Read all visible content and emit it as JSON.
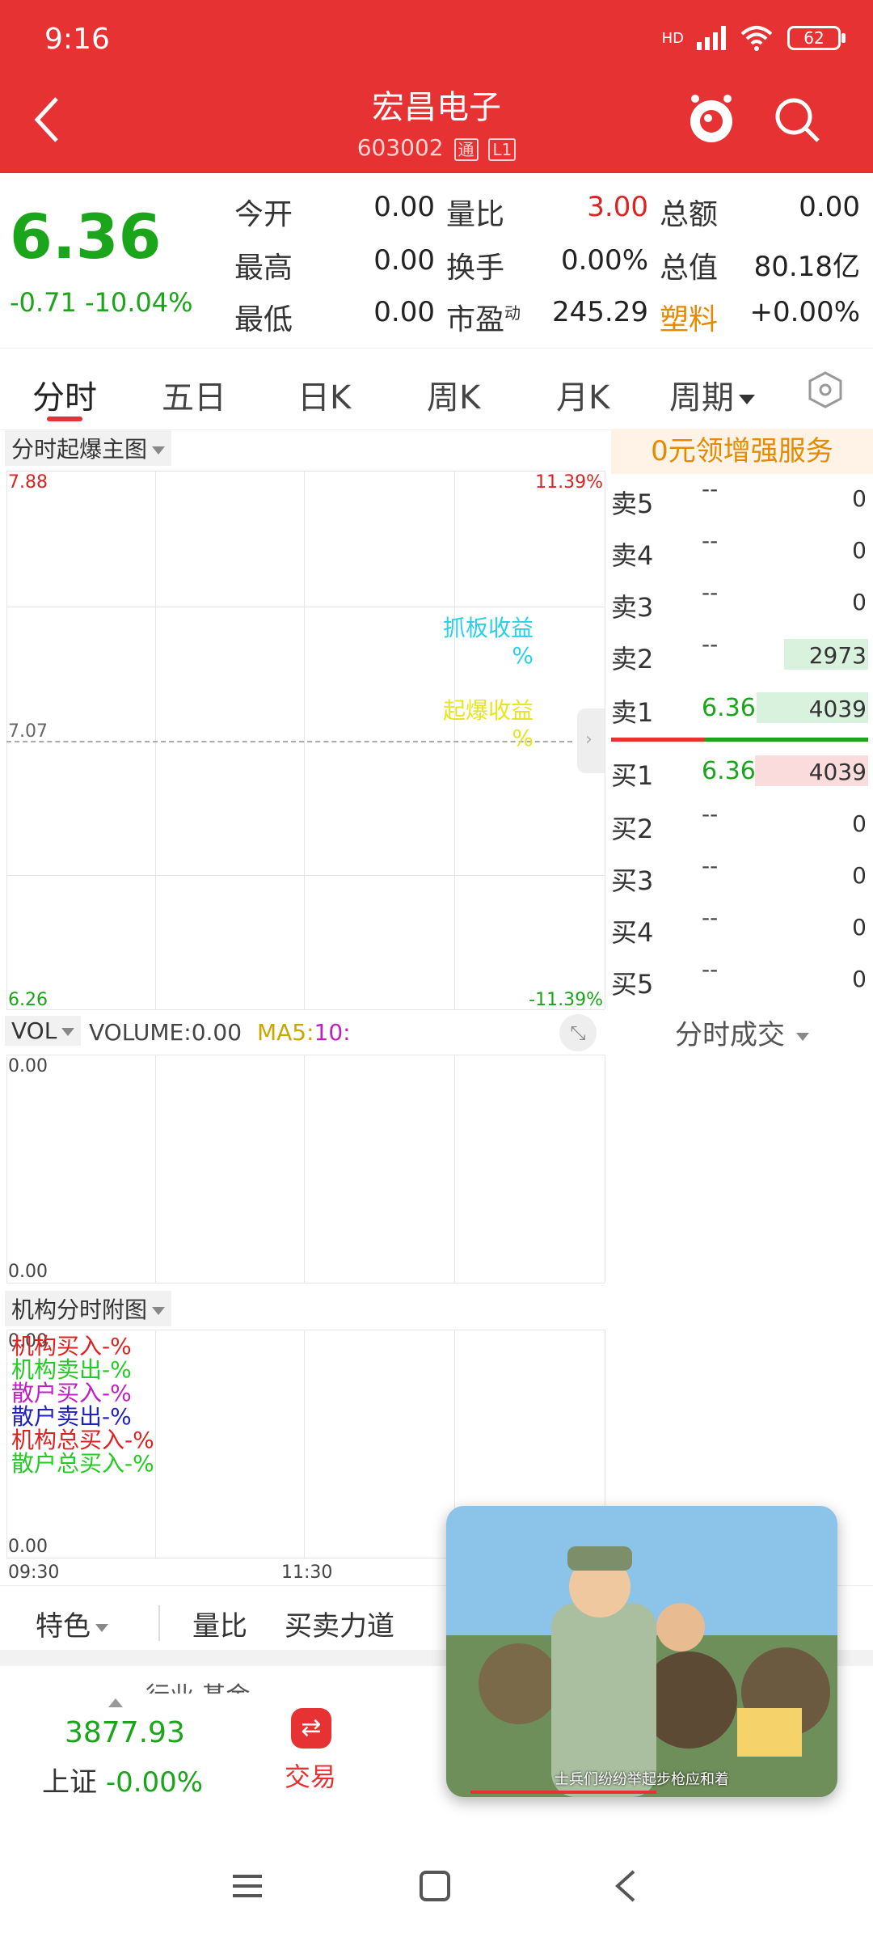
{
  "status": {
    "time": "9:16",
    "network": "HD",
    "battery": "62"
  },
  "header": {
    "title": "宏昌电子",
    "code": "603002",
    "tag1": "通",
    "tag2": "L1"
  },
  "quote": {
    "price": "6.36",
    "change": "-0.71",
    "change_pct": "-10.04%",
    "rows": [
      [
        {
          "label": "今开",
          "value": "0.00"
        },
        {
          "label": "量比",
          "value": "3.00"
        },
        {
          "label": "总额",
          "value": "0.00"
        }
      ],
      [
        {
          "label": "最高",
          "value": "0.00"
        },
        {
          "label": "换手",
          "value": "0.00%"
        },
        {
          "label": "总值",
          "value": "80.18亿"
        }
      ],
      [
        {
          "label": "最低",
          "value": "0.00"
        },
        {
          "label": "市盈",
          "sup": "动",
          "value": "245.29"
        },
        {
          "label": "塑料",
          "value": "+0.00%"
        }
      ]
    ]
  },
  "tabs": [
    "分时",
    "五日",
    "日K",
    "周K",
    "月K",
    "周期"
  ],
  "chart": {
    "main_select": "分时起爆主图",
    "y_top": "7.88",
    "y_mid": "7.07",
    "y_bot": "6.26",
    "pct_top": "11.39%",
    "pct_bot": "-11.39%",
    "label_grab": "抓板收益",
    "label_grab_unit": "%",
    "label_burst": "起爆收益",
    "label_burst_unit": "%",
    "vol_select": "VOL",
    "volume_text": "VOLUME:",
    "volume_val": "0.00",
    "ma5_text": "MA5:",
    "ma5_val": "10:",
    "vol_top": "0.00",
    "vol_bot": "0.00",
    "inst_select": "机构分时附图",
    "inst_top": "0.00",
    "inst_bot": "0.00",
    "inst_lines": [
      {
        "text": "机构买入-%",
        "color": "#d22"
      },
      {
        "text": "机构卖出-%",
        "color": "#22cc22"
      },
      {
        "text": "散户买入-%",
        "color": "#c020c0"
      },
      {
        "text": "散户卖出-%",
        "color": "#2020c0"
      },
      {
        "text": "机构总买入-%",
        "color": "#d22"
      },
      {
        "text": "散户总买入-%",
        "color": "#22cc22"
      }
    ],
    "time_start": "09:30",
    "time_mid": "11:30"
  },
  "orderbook": {
    "promo": "0元领增强服务",
    "sells": [
      {
        "label": "卖5",
        "price": "--",
        "vol": "0"
      },
      {
        "label": "卖4",
        "price": "--",
        "vol": "0"
      },
      {
        "label": "卖3",
        "price": "--",
        "vol": "0"
      },
      {
        "label": "卖2",
        "price": "--",
        "vol": "2973"
      },
      {
        "label": "卖1",
        "price": "6.36",
        "vol": "4039"
      }
    ],
    "buys": [
      {
        "label": "买1",
        "price": "6.36",
        "vol": "4039"
      },
      {
        "label": "买2",
        "price": "--",
        "vol": "0"
      },
      {
        "label": "买3",
        "price": "--",
        "vol": "0"
      },
      {
        "label": "买4",
        "price": "--",
        "vol": "0"
      },
      {
        "label": "买5",
        "price": "--",
        "vol": "0"
      }
    ],
    "trades_label": "分时成交"
  },
  "bottom_tabs": [
    "特色",
    "量比",
    "买卖力道"
  ],
  "bottom_bar": {
    "index_value": "3877.93",
    "index_name": "上证",
    "index_change": "-0.00%",
    "trade_label": "交易",
    "partial_text": "行业 基金"
  },
  "video": {
    "caption": "士兵们纷纷举起步枪应和着"
  },
  "colors": {
    "brand_red": "#e63232",
    "down_green": "#1aa51a",
    "up_red": "#d22"
  }
}
